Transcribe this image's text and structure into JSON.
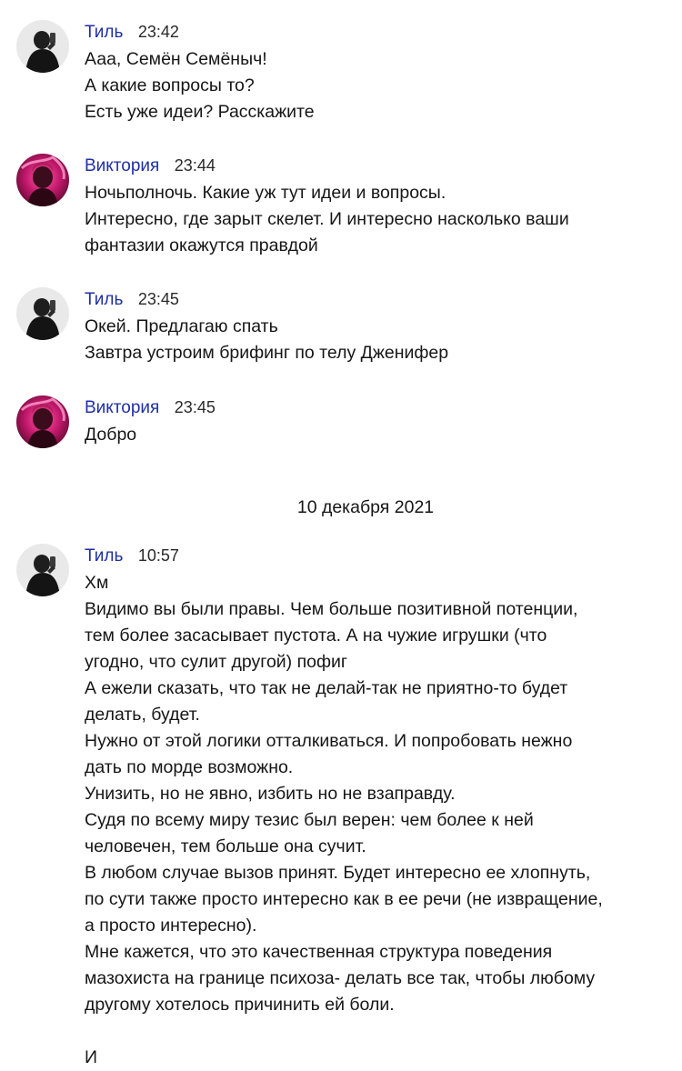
{
  "messages": [
    {
      "author": "Тиль",
      "time": "23:42",
      "avatar": "til-avatar",
      "lines": [
        "Ааа, Семён Семёныч!",
        "А какие вопросы то?",
        "Есть уже идеи? Расскажите"
      ]
    },
    {
      "author": "Виктория",
      "time": "23:44",
      "avatar": "viktoria-avatar",
      "lines": [
        "Ночьполночь. Какие уж тут идеи и вопросы.",
        "Интересно, где зарыт скелет. И интересно насколько ваши",
        "фантазии окажутся правдой"
      ]
    },
    {
      "author": "Тиль",
      "time": "23:45",
      "avatar": "til-avatar",
      "lines": [
        "Окей. Предлагаю спать",
        "Завтра устроим брифинг по телу Дженифер"
      ]
    },
    {
      "author": "Виктория",
      "time": "23:45",
      "avatar": "viktoria-avatar",
      "lines": [
        "Добро"
      ]
    }
  ],
  "date_separator": "10 декабря 2021",
  "last_message": {
    "author": "Тиль",
    "time": "10:57",
    "avatar": "til-avatar",
    "lines": [
      "Хм",
      "Видимо вы были правы. Чем больше позитивной потенции,",
      "тем более засасывает пустота. А на чужие игрушки (что",
      "угодно, что сулит другой) пофиг",
      "А ежели сказать, что так не делай-так не приятно-то будет",
      "делать, будет.",
      "Нужно от этой логики отталкиваться. И попробовать нежно",
      "дать по морде возможно.",
      "Унизить, но не явно, избить но не взаправду.",
      "Судя по всему миру тезис был верен: чем более к ней",
      "человечен, тем больше она сучит.",
      "В любом случае вызов принят. Будет интересно ее хлопнуть,",
      "по сути также просто интересно как в ее речи (не извращение,",
      "а просто интересно).",
      "Мне кажется, что это качественная структура поведения",
      "мазохиста на границе психоза- делать все так, чтобы любому",
      "другому хотелось причинить ей боли.",
      "",
      "И"
    ]
  },
  "colors": {
    "author": "#1f2fa6",
    "text": "#161616",
    "background": "#ffffff"
  }
}
